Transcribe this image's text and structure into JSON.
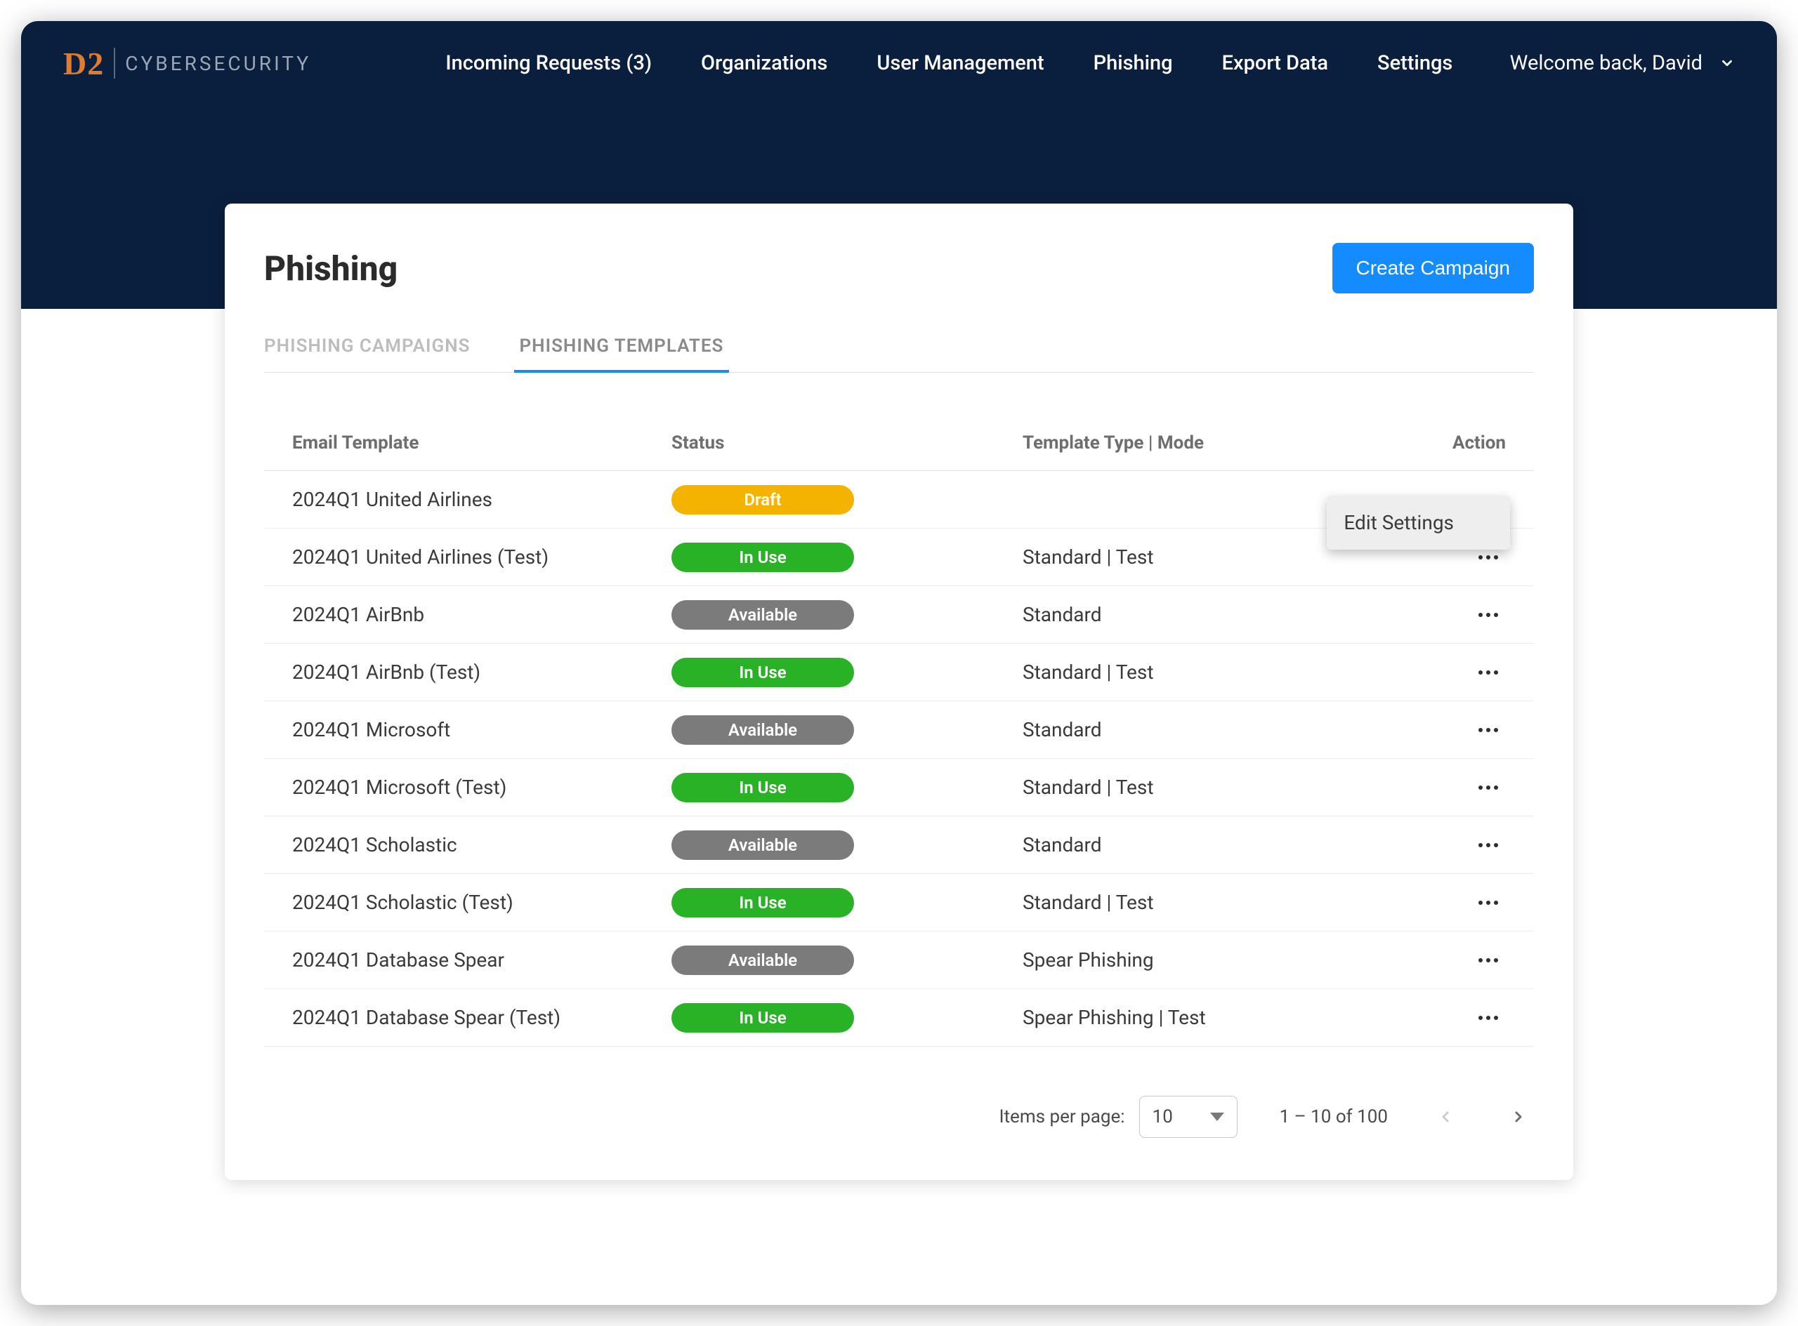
{
  "brand": {
    "logo": "D2",
    "text": "CYBERSECURITY"
  },
  "nav": {
    "incoming_requests": "Incoming Requests (3)",
    "organizations": "Organizations",
    "user_management": "User Management",
    "phishing": "Phishing",
    "export_data": "Export Data",
    "settings": "Settings"
  },
  "welcome": {
    "text": "Welcome back, David"
  },
  "page": {
    "title": "Phishing",
    "create_button": "Create Campaign"
  },
  "tabs": {
    "campaigns": "PHISHING CAMPAIGNS",
    "templates": "PHISHING TEMPLATES"
  },
  "table": {
    "headers": {
      "email_template": "Email Template",
      "status": "Status",
      "template_type": "Template Type | Mode",
      "action": "Action"
    },
    "status_labels": {
      "draft": "Draft",
      "inuse": "In Use",
      "available": "Available"
    },
    "rows": [
      {
        "name": "2024Q1 United Airlines",
        "status": "draft",
        "type": "",
        "menu_open": true
      },
      {
        "name": "2024Q1 United Airlines (Test)",
        "status": "inuse",
        "type": "Standard | Test",
        "menu_open": false
      },
      {
        "name": "2024Q1 AirBnb",
        "status": "available",
        "type": "Standard",
        "menu_open": false
      },
      {
        "name": "2024Q1 AirBnb (Test)",
        "status": "inuse",
        "type": "Standard | Test",
        "menu_open": false
      },
      {
        "name": "2024Q1 Microsoft",
        "status": "available",
        "type": "Standard",
        "menu_open": false
      },
      {
        "name": "2024Q1 Microsoft (Test)",
        "status": "inuse",
        "type": "Standard | Test",
        "menu_open": false
      },
      {
        "name": "2024Q1 Scholastic",
        "status": "available",
        "type": "Standard",
        "menu_open": false
      },
      {
        "name": "2024Q1 Scholastic (Test)",
        "status": "inuse",
        "type": "Standard | Test",
        "menu_open": false
      },
      {
        "name": "2024Q1 Database Spear",
        "status": "available",
        "type": "Spear Phishing",
        "menu_open": false
      },
      {
        "name": "2024Q1 Database Spear (Test)",
        "status": "inuse",
        "type": "Spear Phishing | Test",
        "menu_open": false
      }
    ],
    "row_menu": {
      "edit_settings": "Edit Settings"
    }
  },
  "pagination": {
    "items_per_page_label": "Items per page:",
    "items_per_page_value": "10",
    "range": "1 – 10 of 100"
  }
}
